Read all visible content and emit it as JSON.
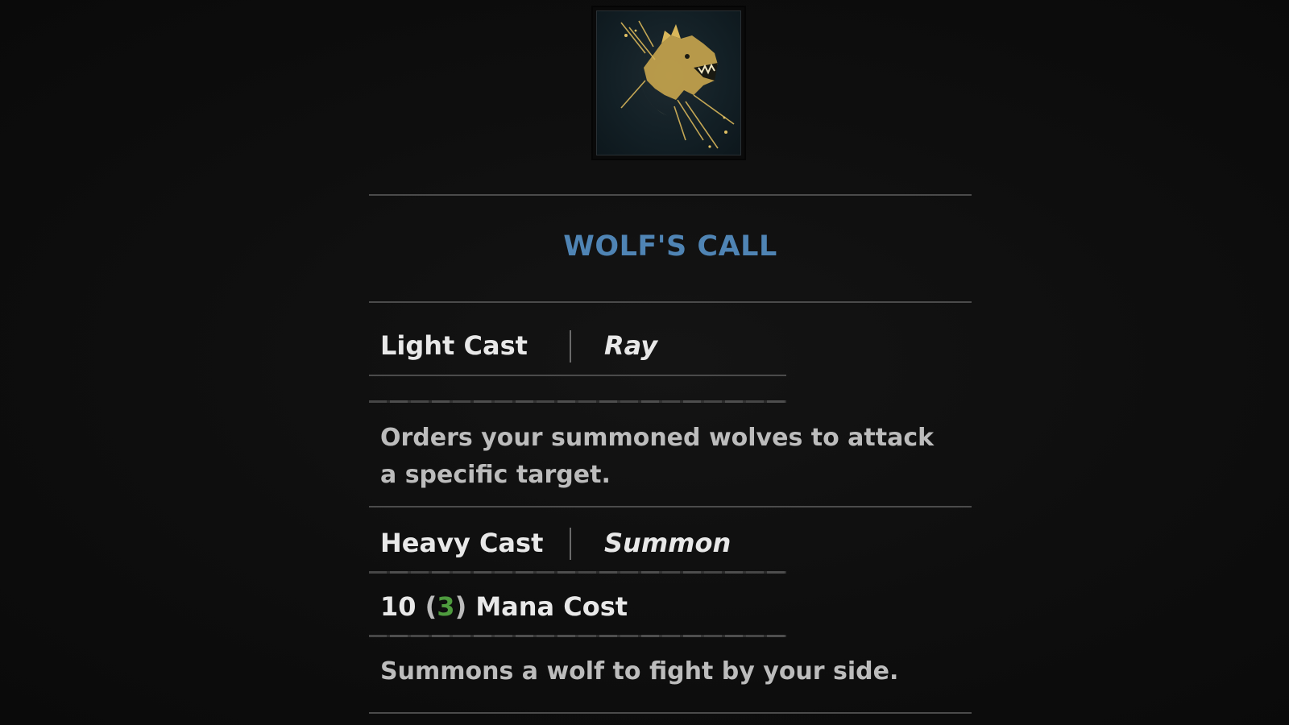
{
  "ability": {
    "name": "WOLF'S CALL",
    "icon": "wolf-crescent-moon-icon",
    "title_color": "#4f84b4"
  },
  "light_cast": {
    "label": "Light Cast",
    "type": "Ray",
    "description": "Orders your summoned wolves to attack a specific target."
  },
  "heavy_cast": {
    "label": "Heavy Cast",
    "type": "Summon",
    "mana_cost_base": "10",
    "mana_cost_reduced": "3",
    "mana_cost_open": "(",
    "mana_cost_close": ")",
    "mana_cost_label": "Mana Cost",
    "reduced_color": "#4e9b3e",
    "description": "Summons a wolf to fight by your side."
  }
}
